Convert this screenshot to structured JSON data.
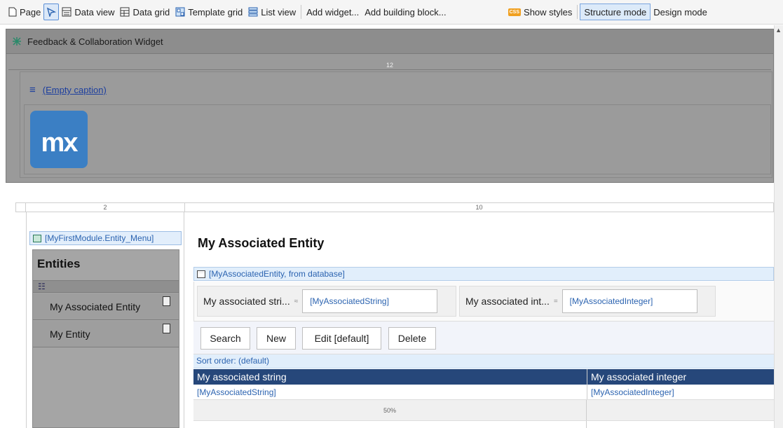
{
  "toolbar": {
    "page_label": "Page",
    "data_view_label": "Data view",
    "data_grid_label": "Data grid",
    "template_grid_label": "Template grid",
    "list_view_label": "List view",
    "add_widget_label": "Add widget...",
    "add_building_block_label": "Add building block...",
    "css_badge": "CSS",
    "show_styles_label": "Show styles",
    "structure_mode_label": "Structure mode",
    "design_mode_label": "Design mode"
  },
  "layout": {
    "header_title": "Feedback & Collaboration Widget",
    "top_ruler": "12",
    "empty_caption": "(Empty caption)",
    "logo_text": "mx",
    "left_ruler": "2",
    "right_ruler": "10"
  },
  "sidebar": {
    "snippet_label": "[MyFirstModule.Entity_Menu]",
    "title": "Entities",
    "items": [
      {
        "label": "My Associated Entity"
      },
      {
        "label": "My Entity"
      }
    ]
  },
  "main": {
    "page_title": "My Associated Entity",
    "data_view_source": "[MyAssociatedEntity, from database]",
    "search_fields": [
      {
        "label": "My associated stri...",
        "operator": "≈",
        "value": "[MyAssociatedString]"
      },
      {
        "label": "My associated int...",
        "operator": "=",
        "value": "[MyAssociatedInteger]"
      }
    ],
    "buttons": {
      "search": "Search",
      "new": "New",
      "edit": "Edit [default]",
      "delete": "Delete"
    },
    "sort_order": "Sort order: (default)",
    "grid": {
      "columns": [
        "My associated string",
        "My associated integer"
      ],
      "row": [
        "[MyAssociatedString]",
        "[MyAssociatedInteger]"
      ],
      "width_label": "50%"
    }
  }
}
